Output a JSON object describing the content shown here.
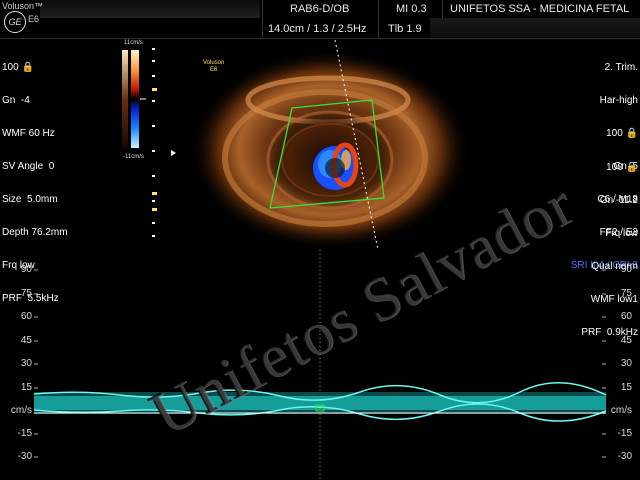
{
  "header": {
    "brand": "Voluson™",
    "model_badge": "E6",
    "logo_text": "GE",
    "probe": "RAB6-D/OB",
    "mi": "MI  0.3",
    "clinic": "UNIFETOS SSA - MEDICINA FETAL",
    "scan_params": "14.0cm / 1.3 / 2.5Hz",
    "tib": "Tlb  1.9"
  },
  "left_params": {
    "power": "100 🔒",
    "gain": "Gn  -4",
    "wmf": "WMF 60 Hz",
    "sv_angle": "SV Angle  0",
    "size": "Size  5.0mm",
    "depth": "Depth 76.2mm",
    "frq": "Frq low",
    "prf": "PRF  5.5kHz"
  },
  "colorbar": {
    "top_label": "11cm/s",
    "bottom_label": "-11cm/s"
  },
  "image_badge": {
    "line1": "Voluson",
    "line2": "E6"
  },
  "right_params_top": {
    "trim": "2. Trim.",
    "har": "Har-high",
    "power": "100 🔒",
    "gain": "Gn  5",
    "c_m": "C6 / M18",
    "ff": "FF2 / E3",
    "sri": "SRI II 4 / CRI 3"
  },
  "right_params_bottom": {
    "power": "100 🔒",
    "gain": "Gn -11.2",
    "frq": "Frq low",
    "qual": "Qual norm",
    "wmf": "WMF low1",
    "prf": "PRF  0.9kHz"
  },
  "doppler_scale": {
    "ticks": [
      "90",
      "75",
      "60",
      "45",
      "30",
      "15",
      "cm/s",
      "-15",
      "-30"
    ],
    "unit": "cm/s"
  },
  "watermark": "Unifetos Salvador",
  "colors": {
    "background": "#000000",
    "accent_blue": "#5a66ff",
    "doppler_cyan": "#2ee8e0",
    "roi_green": "#38e038"
  }
}
